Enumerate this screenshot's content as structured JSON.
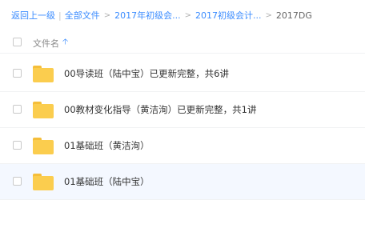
{
  "breadcrumb": {
    "back": "返回上一级",
    "items": [
      "全部文件",
      "2017年初级会...",
      "2017初级会计...",
      "2017DG"
    ],
    "separator": ">"
  },
  "list": {
    "column_name": "文件名",
    "sort_icon": "arrow-up-icon",
    "files": [
      {
        "name": "00导读班（陆中宝）已更新完整，共6讲"
      },
      {
        "name": "00教材变化指导（黄洁洵）已更新完整，共1讲"
      },
      {
        "name": "01基础班（黄洁洵）"
      },
      {
        "name": "01基础班（陆中宝）"
      }
    ]
  },
  "colors": {
    "link": "#3b8cff",
    "folder": "#fbcd4e",
    "selected_row": "#f4f8ff"
  }
}
